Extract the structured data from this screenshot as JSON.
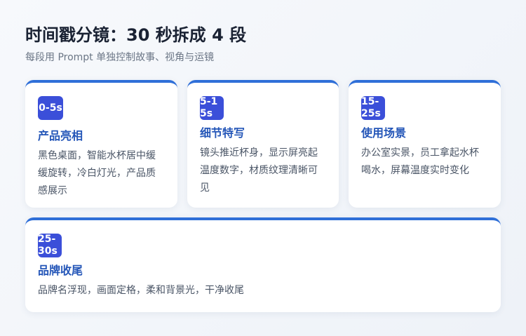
{
  "header": {
    "title": "时间戳分镜：30 秒拆成 4 段",
    "subtitle": "每段用 Prompt 单独控制故事、视角与运镜"
  },
  "colors": {
    "accent": "#2f6fd8",
    "badge": "#3b4fd9",
    "card_title": "#2456b8"
  },
  "cards": [
    {
      "time": "0-5s",
      "title": "产品亮相",
      "desc": "黑色桌面，智能水杯居中缓缓旋转，冷白灯光，产品质感展示"
    },
    {
      "time": "5-15s",
      "title": "细节特写",
      "desc": "镜头推近杯身，显示屏亮起温度数字，材质纹理清晰可见"
    },
    {
      "time": "15-25s",
      "title": "使用场景",
      "desc": "办公室实景，员工拿起水杯喝水，屏幕温度实时变化"
    },
    {
      "time": "25-30s",
      "title": "品牌收尾",
      "desc": "品牌名浮现，画面定格，柔和背景光，干净收尾"
    }
  ]
}
